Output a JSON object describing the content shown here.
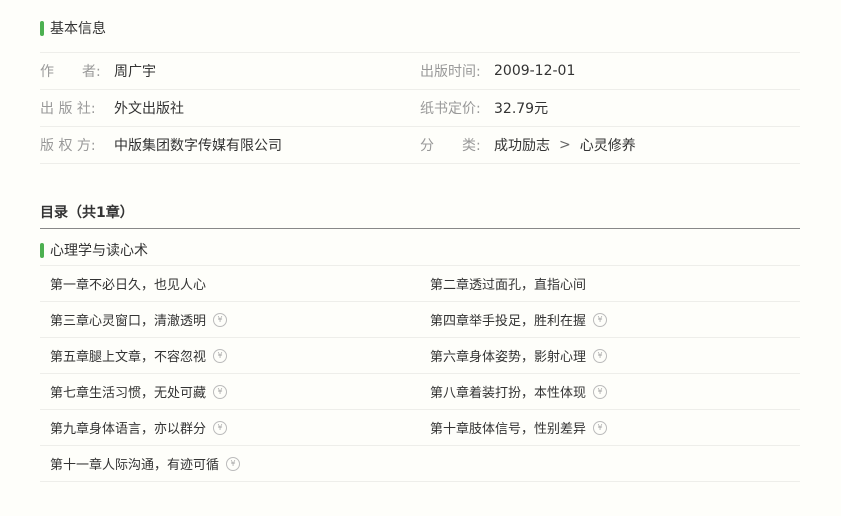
{
  "basic_info": {
    "title": "基本信息",
    "author_label": "作　　者:",
    "author": "周广宇",
    "publish_time_label": "出版时间:",
    "publish_time": "2009-12-01",
    "publisher_label": "出 版 社:",
    "publisher": "外文出版社",
    "price_label": "纸书定价:",
    "price": "32.79元",
    "copyright_label": "版 权 方:",
    "copyright": "中版集团数字传媒有限公司",
    "category_label": "分　　类:",
    "category_main": "成功励志",
    "category_separator": ">",
    "category_sub": "心灵修养"
  },
  "toc": {
    "heading": "目录（共1章）",
    "group_title": "心理学与读心术",
    "chapters": [
      {
        "title": "第一章不必日久，也见人心",
        "paid": false
      },
      {
        "title": "第二章透过面孔，直指心间",
        "paid": false
      },
      {
        "title": "第三章心灵窗口，清澈透明",
        "paid": true
      },
      {
        "title": "第四章举手投足，胜利在握",
        "paid": true
      },
      {
        "title": "第五章腿上文章，不容忽视",
        "paid": true
      },
      {
        "title": "第六章身体姿势，影射心理",
        "paid": true
      },
      {
        "title": "第七章生活习惯，无处可藏",
        "paid": true
      },
      {
        "title": "第八章着装打扮，本性体现",
        "paid": true
      },
      {
        "title": "第九章身体语言，亦以群分",
        "paid": true
      },
      {
        "title": "第十章肢体信号，性别差异",
        "paid": true
      },
      {
        "title": "第十一章人际沟通，有迹可循",
        "paid": true
      }
    ],
    "paid_icon_glyph": "¥",
    "paid_icon": "yen-circle-icon"
  },
  "colors": {
    "accent": "#4cb050",
    "background": "#fefefa"
  }
}
